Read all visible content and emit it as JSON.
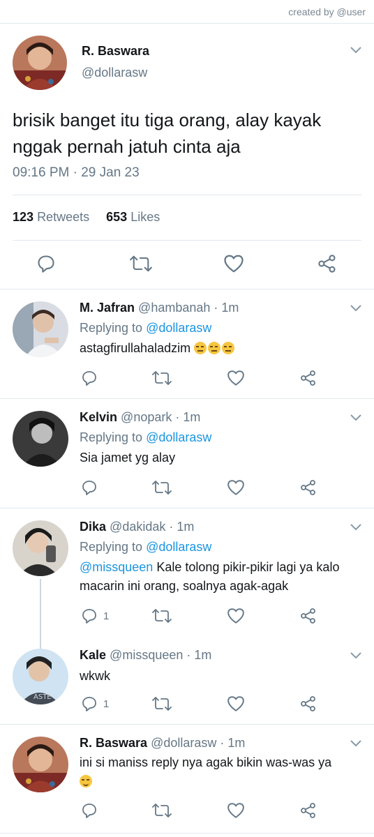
{
  "credit": "created by @user",
  "main": {
    "name": "R. Baswara",
    "handle": "@dollarasw",
    "text": "brisik banget itu tiga orang, alay kayak nggak pernah jatuh cinta aja",
    "time": "09:16 PM · 29 Jan 23",
    "retweets_count": "123",
    "retweets_label": "Retweets",
    "likes_count": "653",
    "likes_label": "Likes"
  },
  "replies": [
    {
      "name": "M. Jafran",
      "handle": "@hambanah · 1m",
      "replying_prefix": "Replying to ",
      "replying_to": "@dollarasw",
      "text": "astagfirullahaladzim",
      "emoji": "expressionless-face-icon ×3",
      "reply_count": ""
    },
    {
      "name": "Kelvin",
      "handle": "@nopark · 1m",
      "replying_prefix": "Replying to ",
      "replying_to": "@dollarasw",
      "text": "Sia jamet yg alay",
      "reply_count": ""
    },
    {
      "name": "Dika",
      "handle": "@dakidak · 1m",
      "replying_prefix": "Replying to ",
      "replying_to": "@dollarasw",
      "mention": "@missqueen",
      "text": " Kale tolong pikir-pikir lagi ya kalo macarin ini orang, soalnya agak-agak",
      "reply_count": "1"
    },
    {
      "name": "Kale",
      "handle": "@missqueen · 1m",
      "text": "wkwk",
      "reply_count": "1"
    },
    {
      "name": "R. Baswara",
      "handle": "@dollarasw · 1m",
      "text": "ini si maniss reply nya agak bikin was-was ya",
      "emoji": "slightly-smiling-face-icon",
      "reply_count": ""
    }
  ],
  "colors": {
    "link": "#1b95e0",
    "secondary": "#657786",
    "divider": "#e1e8ed"
  }
}
